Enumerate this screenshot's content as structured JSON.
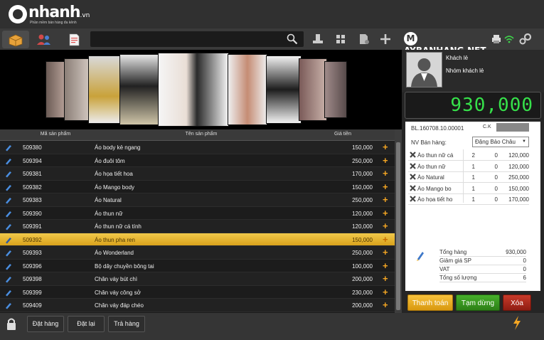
{
  "app": {
    "logo_text": "nhanh",
    "logo_suffix": ".vn",
    "logo_tagline": "Phần mềm bán hàng đa kênh",
    "brand_right": "AYBANHANG.NET",
    "brand_mark": "M"
  },
  "search": {
    "placeholder": "",
    "value": ""
  },
  "grid": {
    "columns": [
      "Mã sản phẩm",
      "Tên sản phẩm",
      "Giá tiền"
    ],
    "rows": [
      {
        "code": "509380",
        "name": "Áo body kẻ ngang",
        "price": "150,000",
        "selected": false
      },
      {
        "code": "509394",
        "name": "Áo đuôi tôm",
        "price": "250,000",
        "selected": false
      },
      {
        "code": "509381",
        "name": "Áo họa tiết hoa",
        "price": "170,000",
        "selected": false
      },
      {
        "code": "509382",
        "name": "Áo Mango body",
        "price": "150,000",
        "selected": false
      },
      {
        "code": "509383",
        "name": "Áo Natural",
        "price": "250,000",
        "selected": false
      },
      {
        "code": "509390",
        "name": "Áo thun nữ",
        "price": "120,000",
        "selected": false
      },
      {
        "code": "509391",
        "name": "Áo thun nữ cá tính",
        "price": "120,000",
        "selected": false
      },
      {
        "code": "509392",
        "name": "Áo thun pha ren",
        "price": "150,000",
        "selected": true
      },
      {
        "code": "509393",
        "name": "Áo Wonderland",
        "price": "250,000",
        "selected": false
      },
      {
        "code": "509396",
        "name": "Bộ dây chuyền bông tai",
        "price": "100,000",
        "selected": false
      },
      {
        "code": "509398",
        "name": "Chân váy bút chì",
        "price": "200,000",
        "selected": false
      },
      {
        "code": "509399",
        "name": "Chân váy công sở",
        "price": "230,000",
        "selected": false
      },
      {
        "code": "509409",
        "name": "Chân váy đáp chéo",
        "price": "200,000",
        "selected": false
      }
    ]
  },
  "bottom": {
    "order": "Đặt hàng",
    "reset": "Đặt lại",
    "return": "Trả hàng"
  },
  "customer": {
    "name": "Khách lẻ",
    "group": "Nhóm khách lẻ"
  },
  "total_display": "930,000",
  "bill": {
    "code": "BL.160708.10.00001",
    "ck_label": "C.K",
    "salesperson_label": "NV Bán hàng:",
    "salesperson": "Đặng Bảo Châu",
    "lines": [
      {
        "name": "Áo thun nữ cá",
        "qty": "2",
        "disc": "0",
        "total": "120,000"
      },
      {
        "name": "Áo thun nữ",
        "qty": "1",
        "disc": "0",
        "total": "120,000"
      },
      {
        "name": "Áo Natural",
        "qty": "1",
        "disc": "0",
        "total": "250,000"
      },
      {
        "name": "Áo Mango bo",
        "qty": "1",
        "disc": "0",
        "total": "150,000"
      },
      {
        "name": "Áo họa tiết ho",
        "qty": "1",
        "disc": "0",
        "total": "170,000"
      }
    ],
    "summary": [
      {
        "label": "Tổng hàng",
        "value": "930,000"
      },
      {
        "label": "Giảm giá SP",
        "value": "0"
      },
      {
        "label": "VAT",
        "value": "0"
      },
      {
        "label": "Tổng số lượng",
        "value": "6"
      }
    ]
  },
  "actions": {
    "pay": "Thanh toán",
    "pause": "Tạm dừng",
    "delete": "Xóa"
  },
  "colors": {
    "accent": "#f5a623",
    "lcd": "#36e04a",
    "pay": "#f2b01e",
    "pause": "#3a9a1e",
    "delete": "#b42a1c"
  }
}
